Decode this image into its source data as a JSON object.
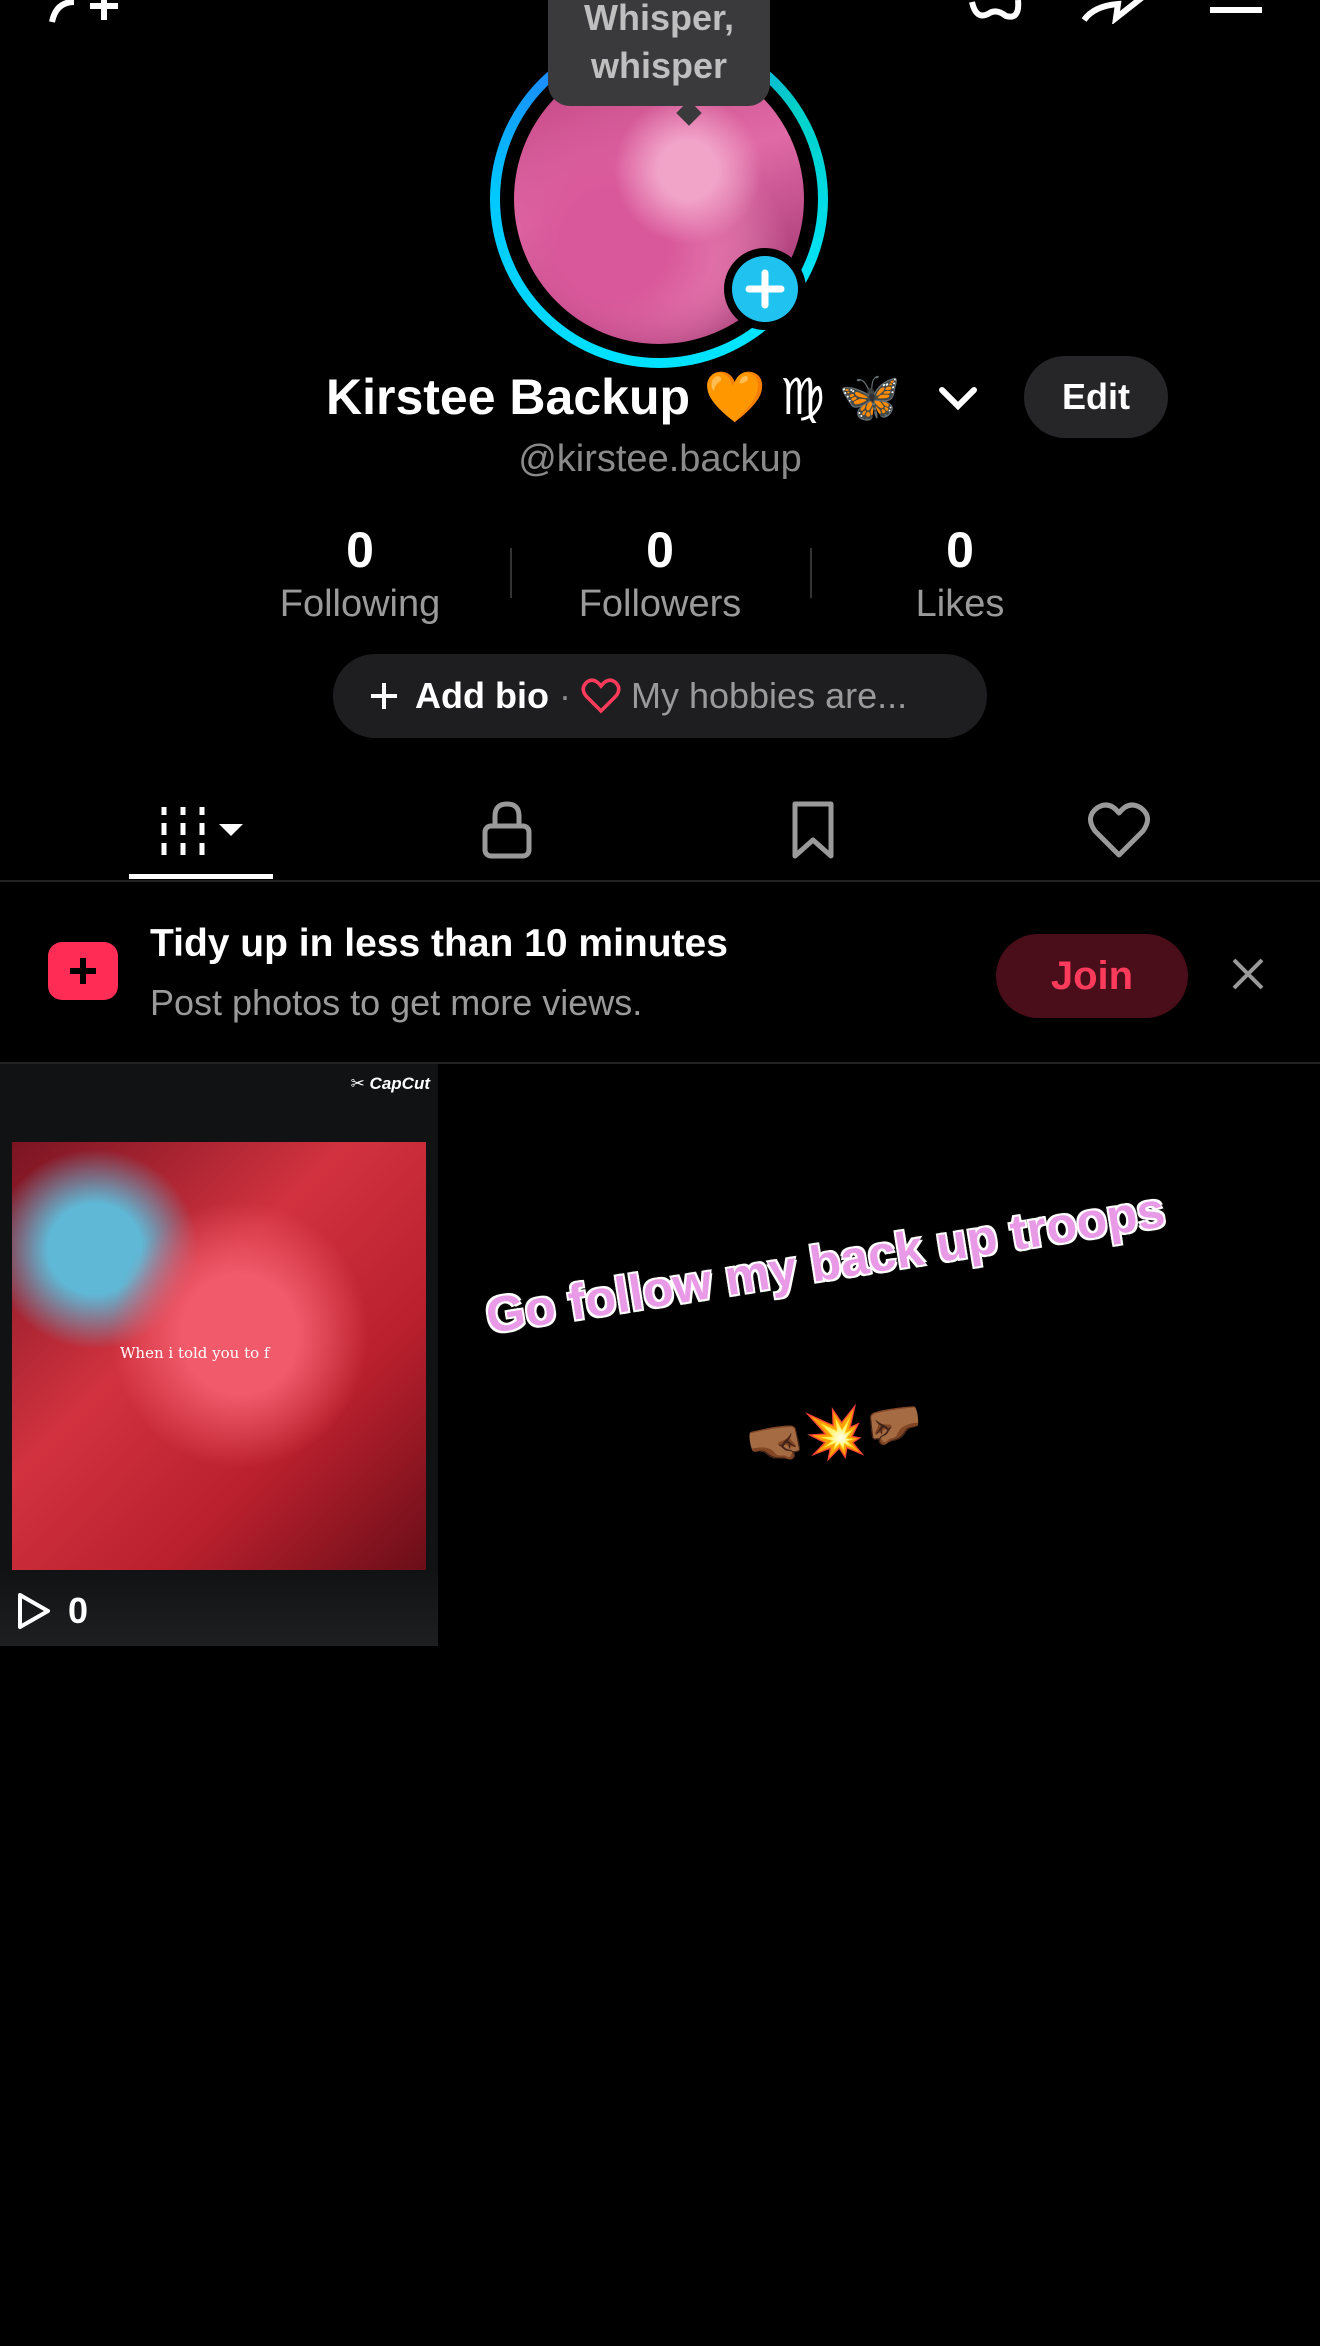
{
  "tooltip": {
    "line1": "Whisper,",
    "line2": "whisper"
  },
  "profile": {
    "display_name": "Kirstee Backup 🧡 ♍ 🦋",
    "handle": "@kirstee.backup",
    "edit_label": "Edit"
  },
  "stats": [
    {
      "value": "0",
      "label": "Following"
    },
    {
      "value": "0",
      "label": "Followers"
    },
    {
      "value": "0",
      "label": "Likes"
    }
  ],
  "bio": {
    "add_label": "Add bio",
    "separator": "·",
    "hobbies": "My hobbies are..."
  },
  "tabs": [
    {
      "icon": "grid-icon"
    },
    {
      "icon": "lock-icon"
    },
    {
      "icon": "bookmark-icon"
    },
    {
      "icon": "heart-icon"
    }
  ],
  "banner": {
    "title": "Tidy up in less than 10 minutes",
    "subtitle": "Post photos to get more views.",
    "join_label": "Join"
  },
  "video": {
    "watermark": "CapCut",
    "caption": "When i told you to f",
    "views": "0"
  },
  "sticker": {
    "text": "Go follow my back up troops",
    "emoji": "🤜🏾💥🤛🏾"
  },
  "colors": {
    "accent_blue": "#20c3f0",
    "join_red": "#ff3b5c",
    "banner_icon": "#ff2d55"
  }
}
